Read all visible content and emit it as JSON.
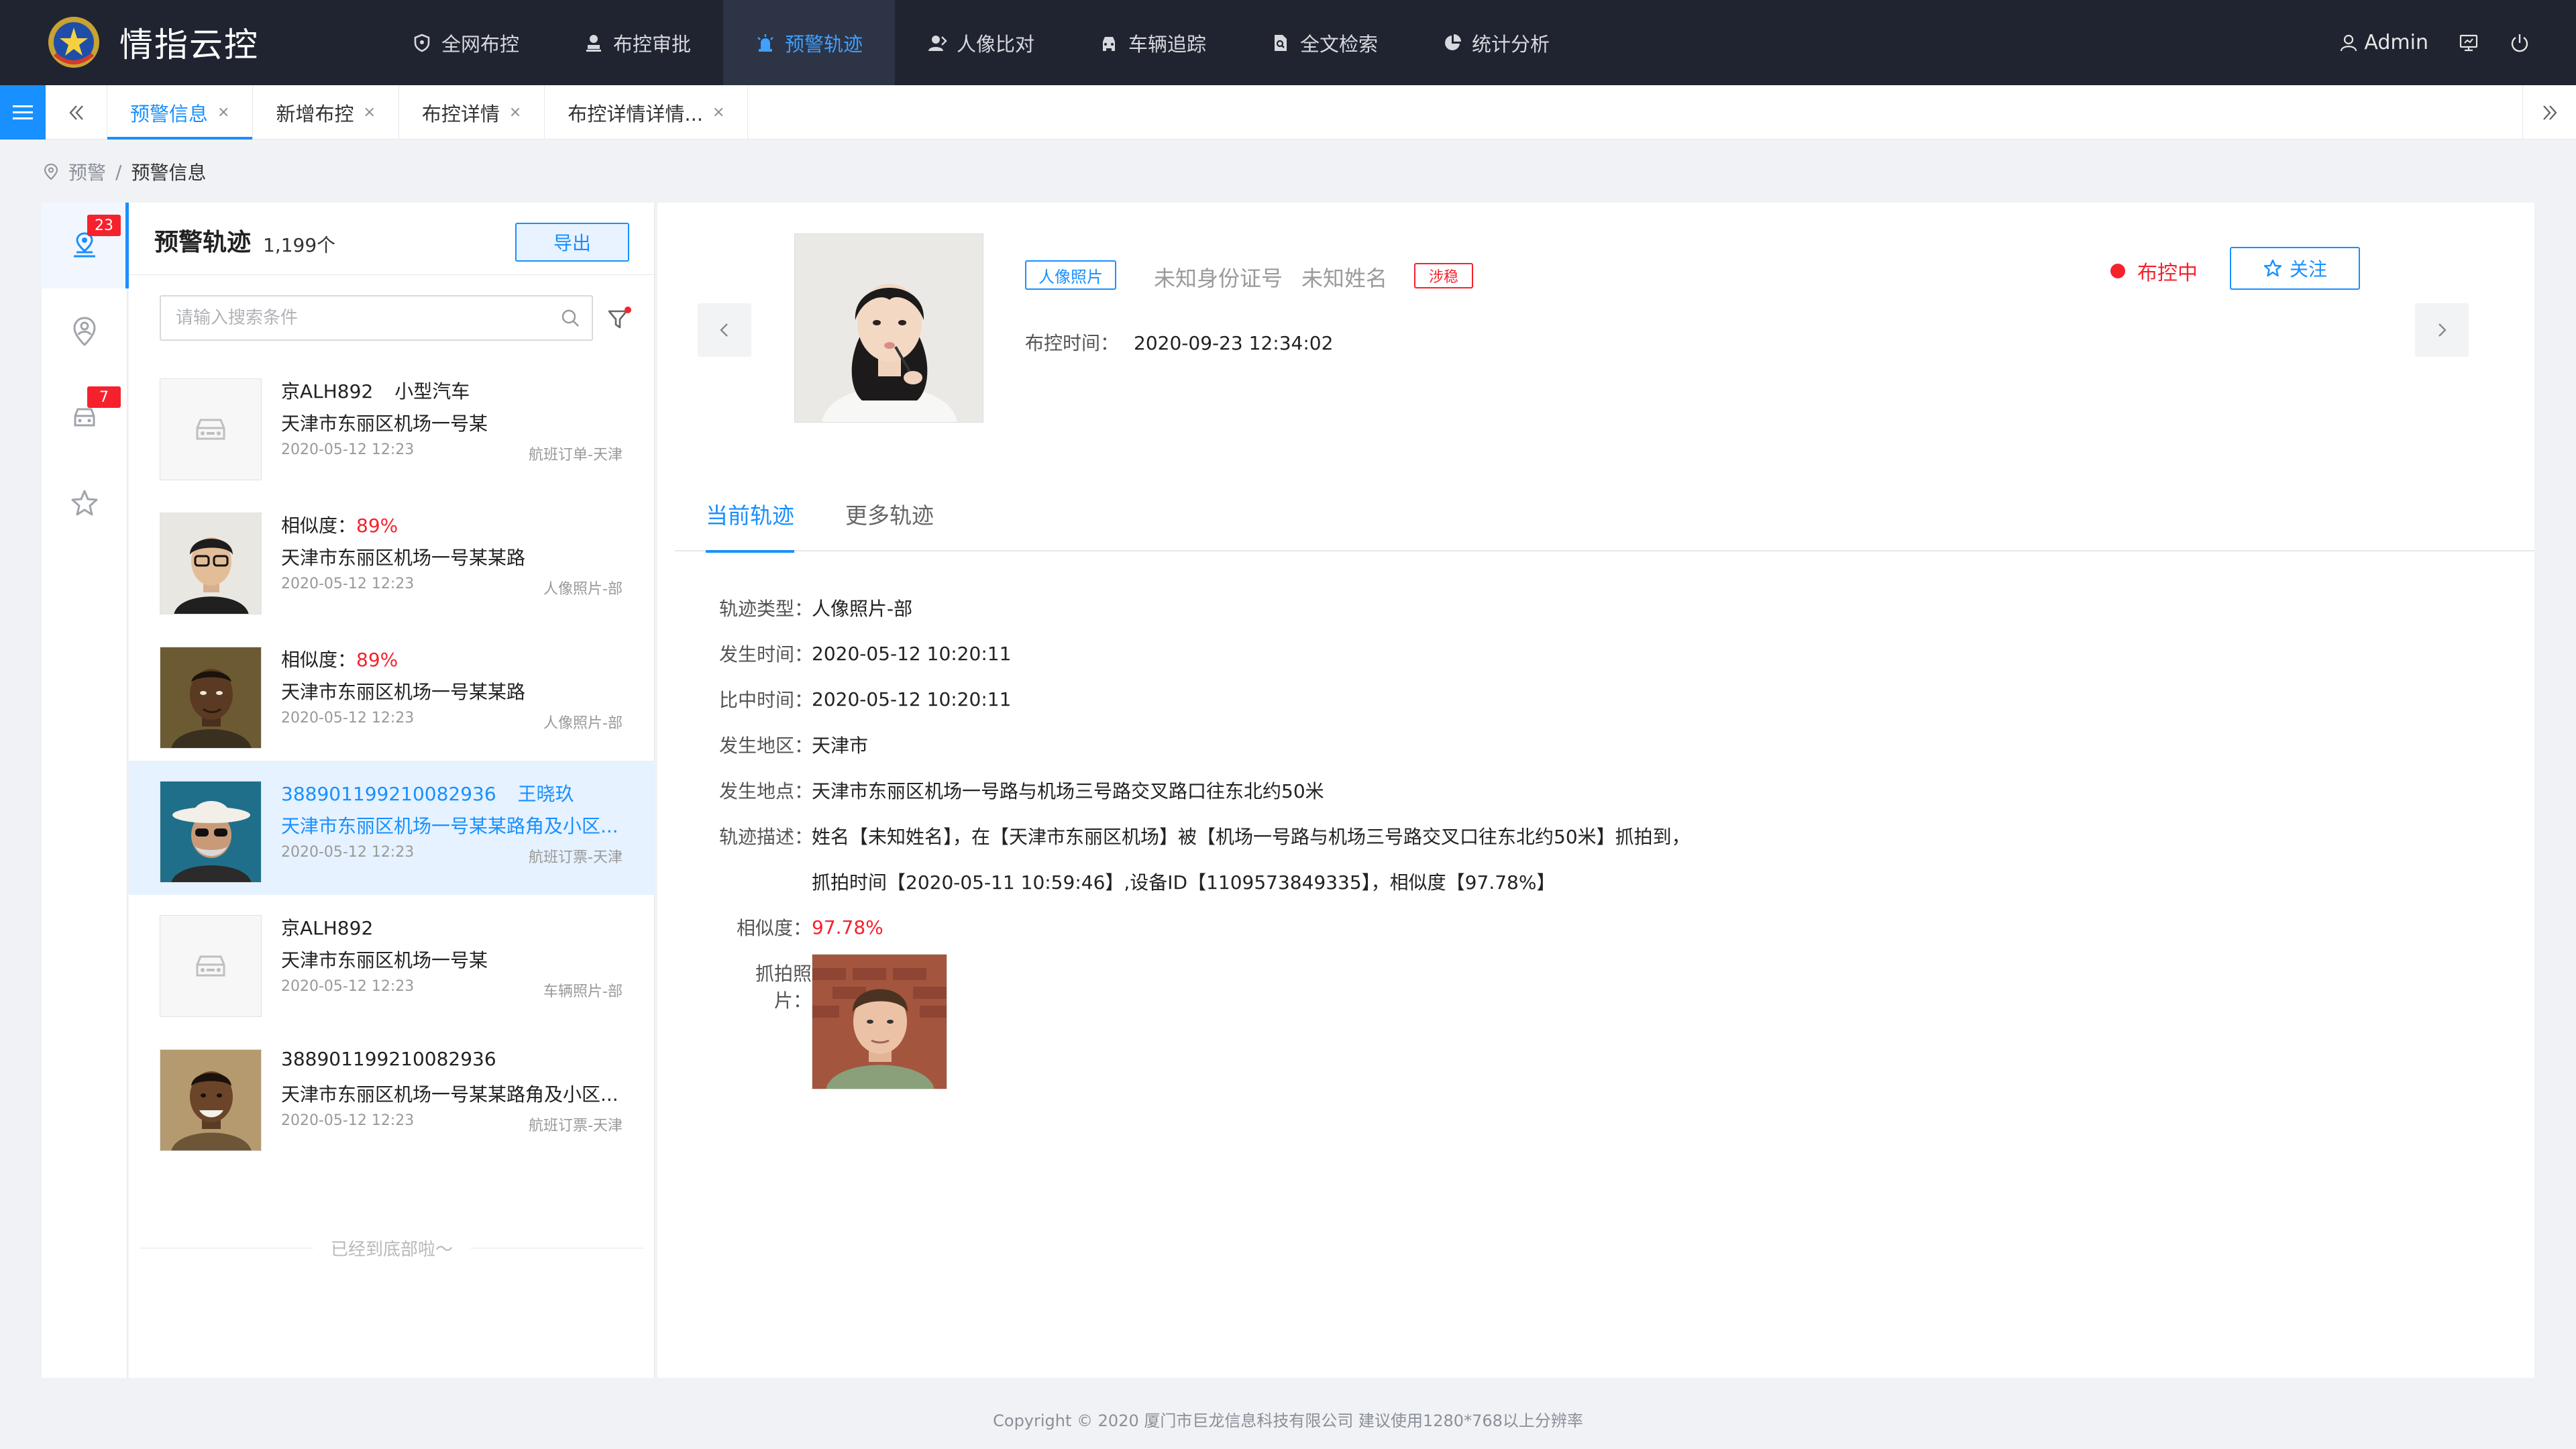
{
  "app": {
    "title": "情指云控"
  },
  "nav": {
    "items": [
      {
        "label": "全网布控",
        "icon": "shield-icon"
      },
      {
        "label": "布控审批",
        "icon": "user-stamp-icon"
      },
      {
        "label": "预警轨迹",
        "icon": "alarm-light-icon",
        "active": true
      },
      {
        "label": "人像比对",
        "icon": "user-compare-icon"
      },
      {
        "label": "车辆追踪",
        "icon": "car-icon"
      },
      {
        "label": "全文检索",
        "icon": "file-search-icon"
      },
      {
        "label": "统计分析",
        "icon": "pie-chart-icon"
      }
    ],
    "user": "Admin"
  },
  "tabs": [
    {
      "label": "预警信息",
      "active": true
    },
    {
      "label": "新增布控"
    },
    {
      "label": "布控详情"
    },
    {
      "label": "布控详情详情..."
    }
  ],
  "breadcrumb": {
    "root": "预警",
    "separator": "/",
    "current": "预警信息"
  },
  "rail": {
    "badges": {
      "alerts": "23",
      "vehicles": "7"
    }
  },
  "list": {
    "title": "预警轨迹",
    "count": "1,199个",
    "export_label": "导出",
    "search_placeholder": "请输入搜索条件",
    "end_text": "已经到底部啦～",
    "items": [
      {
        "kind": "car",
        "l1a": "京ALH892",
        "l1b": "小型汽车",
        "l2": "天津市东丽区机场一号某",
        "time": "2020-05-12  12:23",
        "source": "航班订单-天津"
      },
      {
        "kind": "face",
        "l1_label": "相似度：",
        "l1_value": "89%",
        "l2": "天津市东丽区机场一号某某路",
        "time": "2020-05-12  12:23",
        "source": "人像照片-部"
      },
      {
        "kind": "face",
        "l1_label": "相似度：",
        "l1_value": "89%",
        "l2": "天津市东丽区机场一号某某路",
        "time": "2020-05-12  12:23",
        "source": "人像照片-部"
      },
      {
        "kind": "face",
        "l1a": "388901199210082936",
        "l1b": "王晓玖",
        "l2": "天津市东丽区机场一号某某路角及小区...",
        "time": "2020-05-12  12:23",
        "source": "航班订票-天津",
        "selected": true
      },
      {
        "kind": "car",
        "l1a": "京ALH892",
        "l2": "天津市东丽区机场一号某",
        "time": "2020-05-12  12:23",
        "source": "车辆照片-部"
      },
      {
        "kind": "face",
        "l1a": "388901199210082936",
        "l2": "天津市东丽区机场一号某某路角及小区...",
        "time": "2020-05-12  12:23",
        "source": "航班订票-天津"
      }
    ]
  },
  "detail": {
    "photo_tag": "人像照片",
    "id_number": "未知身份证号",
    "name": "未知姓名",
    "risk_tag": "涉稳",
    "ctrl_time_label": "布控时间：",
    "ctrl_time": "2020-09-23  12:34:02",
    "status": "布控中",
    "follow_label": "关注",
    "tabs": [
      "当前轨迹",
      "更多轨迹"
    ],
    "fields": [
      {
        "label": "轨迹类型：",
        "value": "人像照片-部"
      },
      {
        "label": "发生时间：",
        "value": "2020-05-12  10:20:11"
      },
      {
        "label": "比中时间：",
        "value": "2020-05-12  10:20:11"
      },
      {
        "label": "发生地区：",
        "value": "天津市"
      },
      {
        "label": "发生地点：",
        "value": "天津市东丽区机场一号路与机场三号路交叉路口往东北约50米"
      },
      {
        "label": "轨迹描述：",
        "value": "姓名【未知姓名】，在【天津市东丽区机场】被【机场一号路与机场三号路交叉口往东北约50米】抓拍到，"
      },
      {
        "label": "",
        "value": "抓拍时间【2020-05-11  10:59:46】,设备ID【1109573849335】，相似度【97.78%】"
      },
      {
        "label": "相似度：",
        "value": "97.78%"
      }
    ],
    "capture_label": "抓拍照片："
  },
  "footer": {
    "text": "Copyright © 2020  厦门市巨龙信息科技有限公司  建议使用1280*768以上分辨率"
  },
  "colors": {
    "primary": "#1890ff",
    "danger": "#f5222d",
    "topbar": "#1f2430"
  }
}
